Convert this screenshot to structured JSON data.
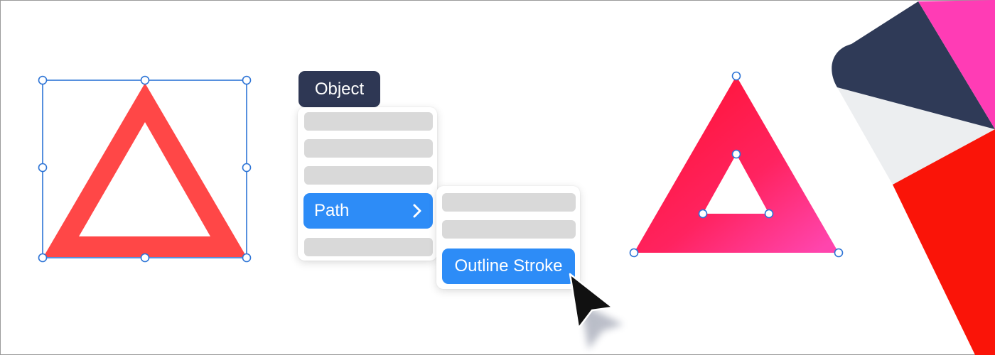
{
  "object_menu": {
    "label": "Object"
  },
  "menu": {
    "path_item": "Path"
  },
  "submenu": {
    "outline_stroke": "Outline Stroke"
  },
  "icons": {
    "chevron": "chevron-right-icon",
    "cursor": "mouse-pointer-icon"
  },
  "colors": {
    "stroke_triangle": "#ff4747",
    "selection": "#2d74d6",
    "menu_header": "#2e3754",
    "menu_highlight": "#2d8cf7",
    "menu_placeholder": "#d9d9d9",
    "gradient_start": "#ff1437",
    "gradient_end": "#ff45ad",
    "logo_navy": "#2f3a57",
    "logo_pink": "#ff3cb5",
    "logo_red": "#fa1408",
    "logo_gray": "#eceef0"
  }
}
